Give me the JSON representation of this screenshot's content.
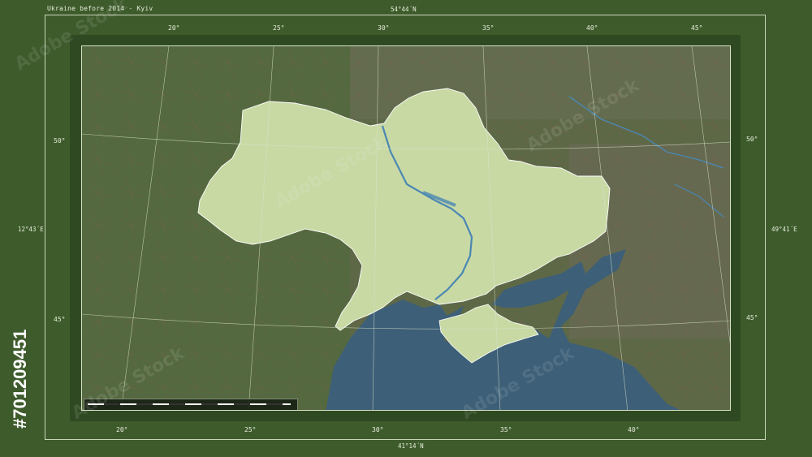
{
  "title": "Ukraine before 2014 - Kyiv",
  "coords": {
    "top": "54°44´N",
    "bottom": "41°14´N",
    "left": "12°43´E",
    "right": "49°41´E"
  },
  "lon_ticks_top": [
    "20°",
    "25°",
    "30°",
    "35°",
    "40°",
    "45°"
  ],
  "lon_ticks_bottom": [
    "20°",
    "25°",
    "30°",
    "35°",
    "40°"
  ],
  "lat_ticks_left": [
    "50°",
    "45°"
  ],
  "lat_ticks_right": [
    "50°",
    "45°"
  ],
  "image_id": "#701209451",
  "watermark": "Adobe Stock",
  "colors": {
    "frame_bg": "#3e5b2c",
    "land": "#5f6a48",
    "highlight": "#c8d9a4",
    "sea": "#3d5f78"
  }
}
